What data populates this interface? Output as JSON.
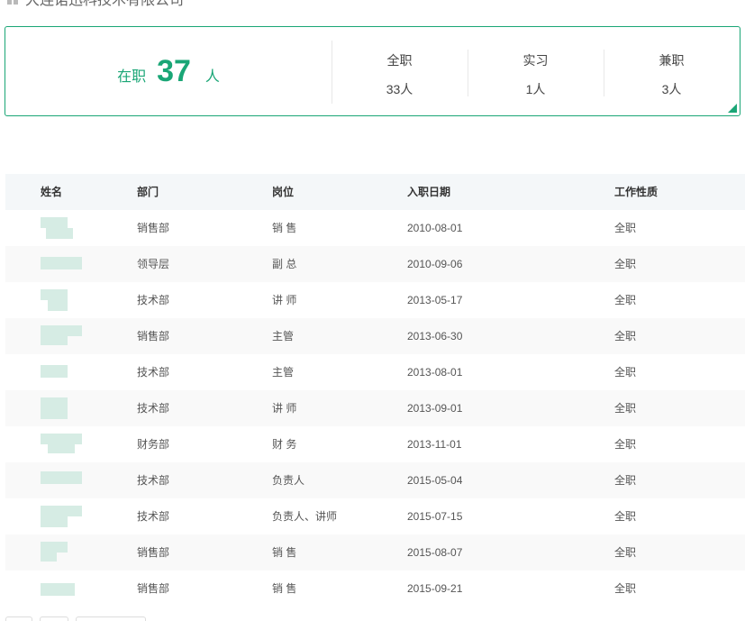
{
  "company": {
    "name": "大连诺迅科技术有限公司"
  },
  "summary": {
    "label": "在职",
    "count": "37",
    "unit": "人",
    "stats": [
      {
        "name": "全职",
        "value": "33人"
      },
      {
        "name": "实习",
        "value": "1人"
      },
      {
        "name": "兼职",
        "value": "3人"
      }
    ],
    "accent_color": "#1aa676"
  },
  "table": {
    "headers": {
      "name": "姓名",
      "dept": "部门",
      "position": "岗位",
      "date": "入职日期",
      "type": "工作性质"
    },
    "rows": [
      {
        "dept": "销售部",
        "position": "销 售",
        "date": "2010-08-01",
        "type": "全职"
      },
      {
        "dept": "领导层",
        "position": "副 总",
        "date": "2010-09-06",
        "type": "全职"
      },
      {
        "dept": "技术部",
        "position": "讲 师",
        "date": "2013-05-17",
        "type": "全职"
      },
      {
        "dept": "销售部",
        "position": "主管",
        "date": "2013-06-30",
        "type": "全职"
      },
      {
        "dept": "技术部",
        "position": "主管",
        "date": "2013-08-01",
        "type": "全职"
      },
      {
        "dept": "技术部",
        "position": "讲 师",
        "date": "2013-09-01",
        "type": "全职"
      },
      {
        "dept": "财务部",
        "position": "财 务",
        "date": "2013-11-01",
        "type": "全职"
      },
      {
        "dept": "技术部",
        "position": "负责人",
        "date": "2015-05-04",
        "type": "全职"
      },
      {
        "dept": "技术部",
        "position": "负责人、讲师",
        "date": "2015-07-15",
        "type": "全职"
      },
      {
        "dept": "销售部",
        "position": "销 售",
        "date": "2015-08-07",
        "type": "全职"
      },
      {
        "dept": "销售部",
        "position": "销 售",
        "date": "2015-09-21",
        "type": "全职"
      }
    ]
  }
}
